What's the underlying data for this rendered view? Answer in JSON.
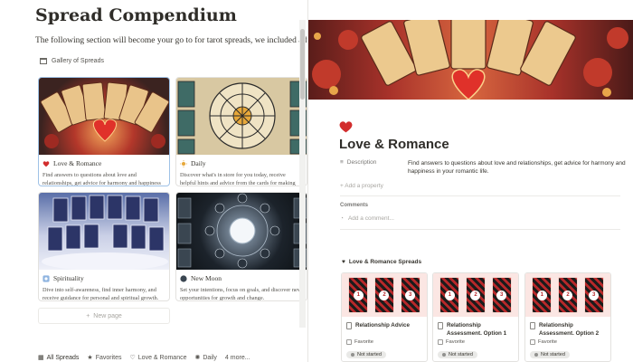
{
  "left": {
    "page_title": "Spread Compendium",
    "intro": "The following section will become your go to for tarot spreads, we included a few of our fa",
    "gallery_label": "Gallery of Spreads",
    "cards": [
      {
        "title": "Love & Romance",
        "icon": "heart-icon",
        "desc": "Find answers to questions about love and relationships, get advice for harmony and happiness in your romantic life."
      },
      {
        "title": "Daily",
        "icon": "sun-icon",
        "desc": "Discover what's in store for you today, receive helpful hints and advice from the cards for making important decision"
      },
      {
        "title": "Spirituality",
        "icon": "spirit-icon",
        "desc": "Dive into self-awareness, find inner harmony, and receive guidance for personal and spiritual growth."
      },
      {
        "title": "New Moon",
        "icon": "new-moon-icon",
        "desc": "Set your intentions, focus on goals, and discover new opportunities for growth and change."
      }
    ],
    "new_page": "New page",
    "tabs": [
      {
        "label": "All Spreads",
        "icon": "gallery-icon"
      },
      {
        "label": "Favorites",
        "icon": "star-icon"
      },
      {
        "label": "Love & Romance",
        "icon": "heart-outline-icon"
      },
      {
        "label": "Daily",
        "icon": "sun-icon"
      },
      {
        "label": "4 more...",
        "icon": ""
      }
    ]
  },
  "right": {
    "title": "Love & Romance",
    "description_label": "Description",
    "description_value": "Find answers to questions about love and relationships, get advice for harmony and happiness in your romantic life.",
    "add_property": "Add a property",
    "comments_label": "Comments",
    "add_comment": "Add a comment...",
    "spreads_label": "Love & Romance Spreads",
    "spread_cards": [
      {
        "title": "Relationship Advice",
        "favorite": "Favorite",
        "status": "Not started"
      },
      {
        "title": "Relationship Assessment. Option 1",
        "favorite": "Favorite",
        "status": "Not started"
      },
      {
        "title": "Relationship Assessment. Option 2",
        "favorite": "Favorite",
        "status": "Not started"
      }
    ]
  },
  "colors": {
    "heart": "#d22d2d",
    "selected_border": "#9fc2e7",
    "status_bg": "#e9e9e7"
  }
}
